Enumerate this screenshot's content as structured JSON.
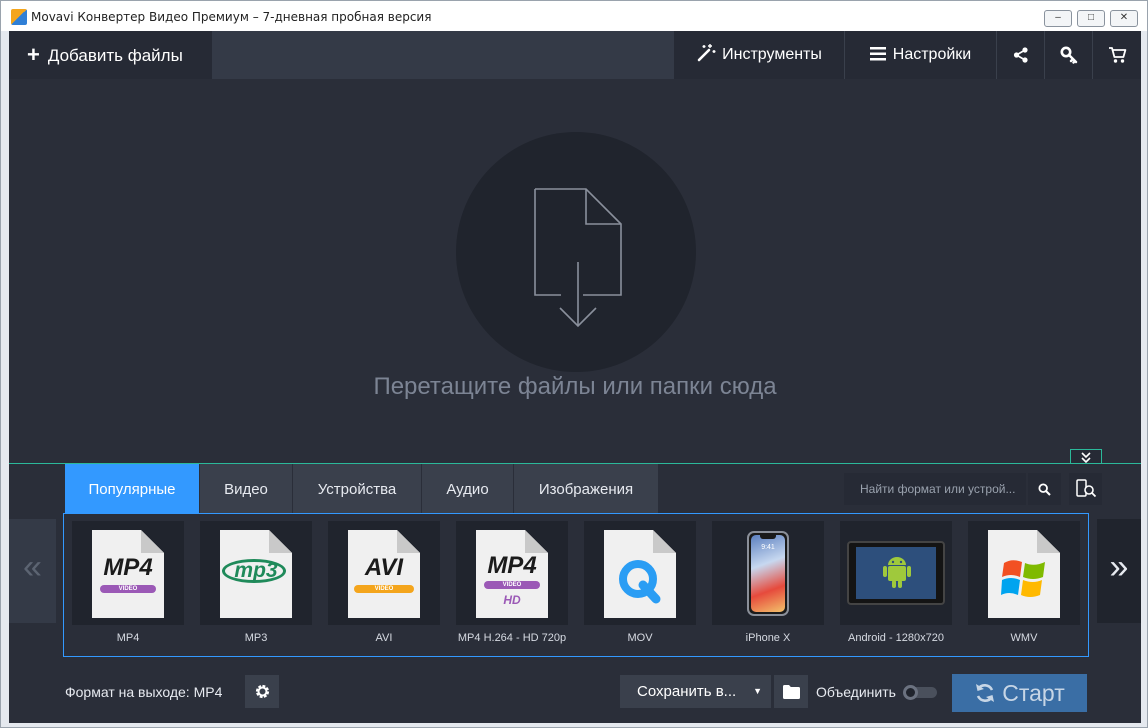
{
  "window": {
    "title": "Movavi Конвертер Видео Премиум – 7-дневная пробная версия",
    "minimize": "–",
    "maximize": "□",
    "close": "✕"
  },
  "toolbar": {
    "add_files": "Добавить файлы",
    "tools": "Инструменты",
    "settings": "Настройки",
    "icons": [
      "share-icon",
      "key-icon",
      "cart-icon"
    ]
  },
  "dropzone": {
    "text": "Перетащите файлы или папки сюда"
  },
  "tabs": [
    {
      "label": "Популярные",
      "active": true
    },
    {
      "label": "Видео",
      "active": false
    },
    {
      "label": "Устройства",
      "active": false
    },
    {
      "label": "Аудио",
      "active": false
    },
    {
      "label": "Изображения",
      "active": false
    }
  ],
  "search": {
    "placeholder": "Найти формат или устрой..."
  },
  "carousel": {
    "prev": "«",
    "next": "»"
  },
  "formats": [
    {
      "label": "MP4",
      "icon": "mp4-file-icon",
      "badge": "MP4",
      "band": "VIDEO"
    },
    {
      "label": "MP3",
      "icon": "mp3-file-icon",
      "badge": "mp3"
    },
    {
      "label": "AVI",
      "icon": "avi-file-icon",
      "badge": "AVI",
      "band": "VIDEO"
    },
    {
      "label": "MP4 H.264 - HD 720p",
      "icon": "mp4-hd-file-icon",
      "badge": "MP4",
      "band": "VIDEO",
      "sub": "HD"
    },
    {
      "label": "MOV",
      "icon": "quicktime-icon"
    },
    {
      "label": "iPhone X",
      "icon": "iphone-icon",
      "screen_time": "9:41"
    },
    {
      "label": "Android - 1280x720",
      "icon": "android-tablet-icon"
    },
    {
      "label": "WMV",
      "icon": "windows-media-icon"
    }
  ],
  "bottom": {
    "output_label": "Формат на выходе: MP4",
    "save_to": "Сохранить в...",
    "merge": "Объединить",
    "merge_on": false,
    "start": "Старт"
  },
  "colors": {
    "accent": "#3399ff",
    "panel": "#2a2e39",
    "teal": "#2bb99a",
    "start": "#3a6ea5"
  }
}
